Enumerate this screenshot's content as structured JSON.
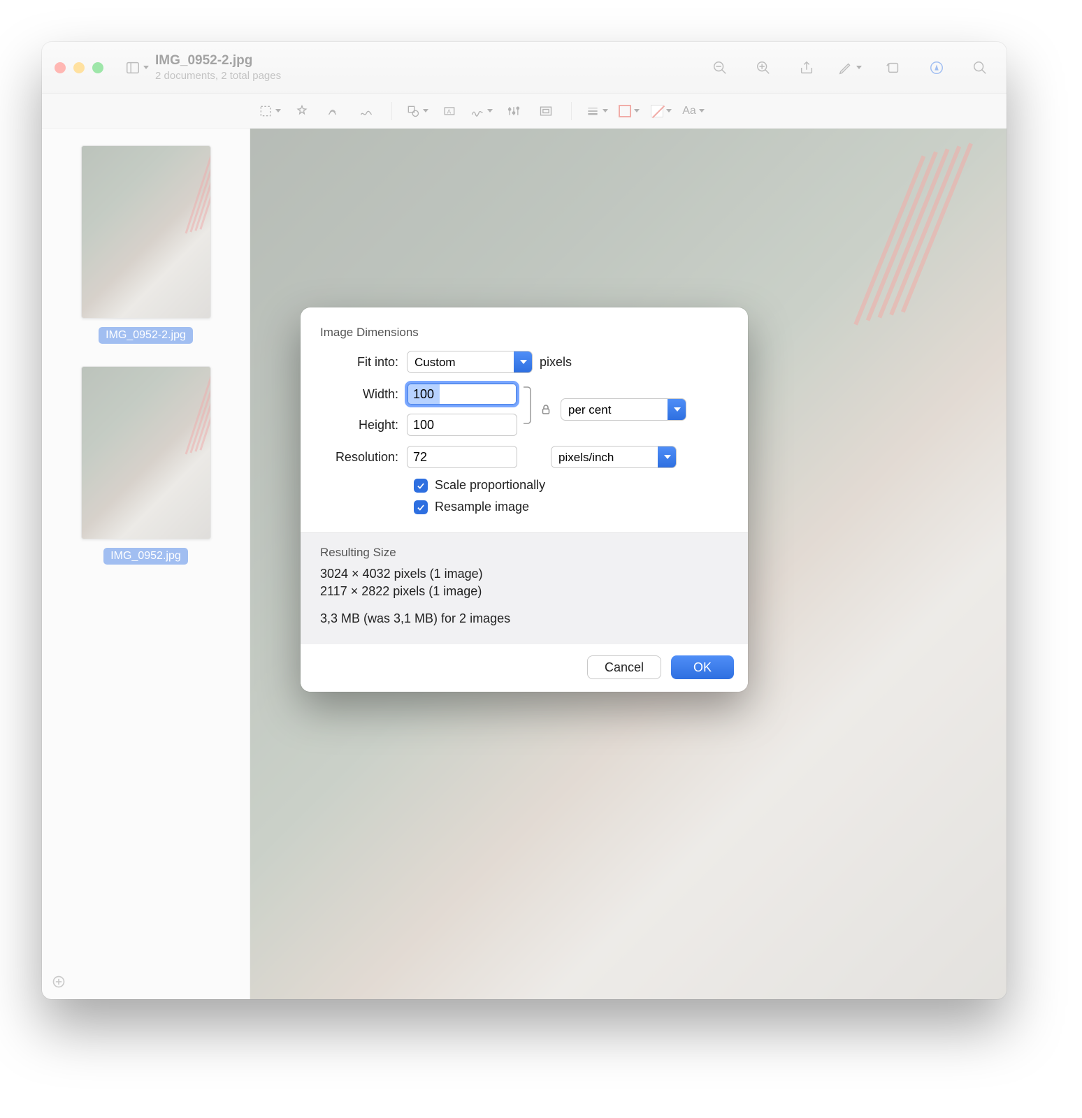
{
  "window": {
    "title": "IMG_0952-2.jpg",
    "subtitle": "2 documents, 2 total pages"
  },
  "sidebar": {
    "thumbs": [
      {
        "label": "IMG_0952-2.jpg"
      },
      {
        "label": "IMG_0952.jpg"
      }
    ]
  },
  "dialog": {
    "section_title": "Image Dimensions",
    "fit_label": "Fit into:",
    "fit_value": "Custom",
    "fit_unit": "pixels",
    "width_label": "Width:",
    "width_value": "100",
    "height_label": "Height:",
    "height_value": "100",
    "wh_unit": "per cent",
    "res_label": "Resolution:",
    "res_value": "72",
    "res_unit": "pixels/inch",
    "scale_label": "Scale proportionally",
    "resample_label": "Resample image",
    "result_title": "Resulting Size",
    "result_line1": "3024 × 4032 pixels (1 image)",
    "result_line2": "2117 × 2822 pixels (1 image)",
    "result_line3": "3,3 MB (was 3,1 MB) for 2 images",
    "cancel": "Cancel",
    "ok": "OK"
  },
  "formatbar": {
    "text_style": "Aa"
  }
}
